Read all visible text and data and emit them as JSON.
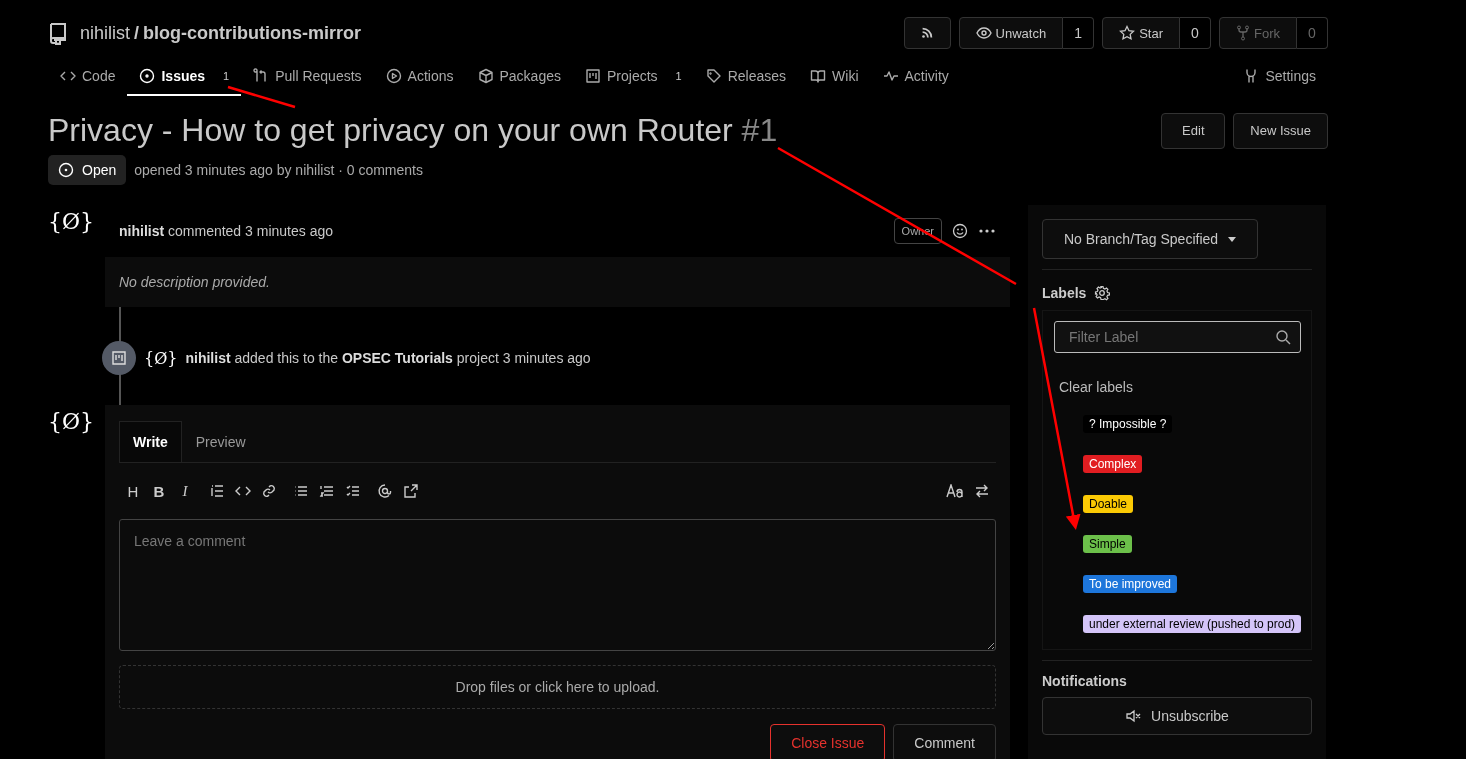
{
  "repo": {
    "owner": "nihilist",
    "separator": "/",
    "name": "blog-contributions-mirror"
  },
  "repo_actions": [
    {
      "kind": "rss"
    },
    {
      "kind": "watch",
      "label": "Unwatch",
      "count": "1",
      "disabled": false
    },
    {
      "kind": "star",
      "label": "Star",
      "count": "0",
      "disabled": false
    },
    {
      "kind": "fork",
      "label": "Fork",
      "count": "0",
      "disabled": true
    }
  ],
  "tabs": [
    {
      "label": "Code",
      "selected": false
    },
    {
      "label": "Issues",
      "count": "1",
      "selected": true
    },
    {
      "label": "Pull Requests",
      "selected": false
    },
    {
      "label": "Actions",
      "selected": false
    },
    {
      "label": "Packages",
      "selected": false
    },
    {
      "label": "Projects",
      "count": "1",
      "selected": false
    },
    {
      "label": "Releases",
      "selected": false
    },
    {
      "label": "Wiki",
      "selected": false
    },
    {
      "label": "Activity",
      "selected": false
    }
  ],
  "settings_tab": {
    "label": "Settings",
    "selected": false
  },
  "issue": {
    "title": "Privacy - How to get privacy on your own Router",
    "number": "#1",
    "state": "Open",
    "meta": "opened 3 minutes ago by nihilist · 0 comments"
  },
  "header_buttons": [
    "Edit",
    "New Issue"
  ],
  "comment": {
    "avatar": "{Ø}",
    "author": "nihilist",
    "action": "commented 3 minutes ago",
    "role": "Owner",
    "body": "No description provided."
  },
  "event": {
    "avatar": "{Ø}",
    "actor": "nihilist",
    "text_before": "added this to the",
    "project": "OPSEC Tutorials",
    "text_after": "project 3 minutes ago"
  },
  "editor": {
    "avatar": "{Ø}",
    "tabs": [
      {
        "label": "Write",
        "selected": true
      },
      {
        "label": "Preview",
        "selected": false
      }
    ],
    "toolbar_left": [
      "H",
      "B",
      "I"
    ],
    "placeholder": "Leave a comment",
    "dropzone": "Drop files or click here to upload.",
    "buttons": [
      {
        "label": "Close Issue",
        "kind": "danger"
      },
      {
        "label": "Comment",
        "kind": "default"
      }
    ]
  },
  "sidebar": {
    "branch": "No Branch/Tag Specified",
    "labels_title": "Labels",
    "filter_placeholder": "Filter Label",
    "clear": "Clear labels",
    "labels": [
      {
        "name": "? Impossible ?",
        "color": "#000000"
      },
      {
        "name": "Complex",
        "color": "#e11d21"
      },
      {
        "name": "Doable",
        "color": "#fbca04"
      },
      {
        "name": "Simple",
        "color": "#6cc04a"
      },
      {
        "name": "To be improved",
        "color": "#1d76db"
      },
      {
        "name": "under external review (pushed to prod)",
        "color": "#d4c5f9"
      }
    ],
    "notifications_title": "Notifications",
    "unsubscribe": "Unsubscribe"
  }
}
